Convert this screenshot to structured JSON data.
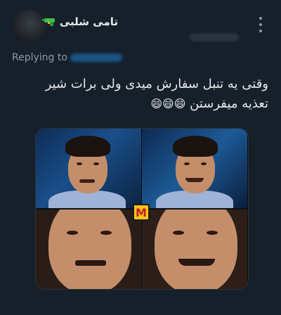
{
  "tweet": {
    "author_name": "تامی شلبی",
    "reply_label": "Replying to",
    "text_line1": "وقتی یه تنبل سفارش میدی ولی برات شیر",
    "text_line2": "تعذیه میفرستن",
    "emojis": "😄😄😄"
  },
  "media": {
    "logo_letter": "M"
  }
}
